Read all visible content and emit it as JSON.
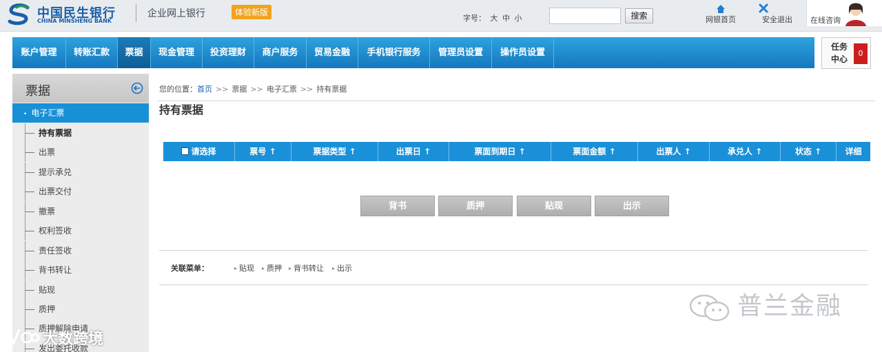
{
  "header": {
    "bank_name_cn": "中国民生银行",
    "bank_name_en": "CHINA MINSHENG BANK",
    "subtitle": "企业网上银行",
    "badge": "体验新版",
    "font_size_label": "字号：",
    "font_sizes": [
      "大",
      "中",
      "小"
    ],
    "search_value": "",
    "search_button": "搜索",
    "home_link": "网银首页",
    "logout_link": "安全退出",
    "consult": "在线咨询"
  },
  "nav": {
    "items": [
      "账户管理",
      "转账汇款",
      "票据",
      "现金管理",
      "投资理财",
      "商户服务",
      "贸易金融",
      "手机银行服务",
      "管理员设置",
      "操作员设置"
    ],
    "active": "票据"
  },
  "task_center": {
    "label": "任务中心",
    "count": "0"
  },
  "sidebar": {
    "title": "票据",
    "group": "电子汇票",
    "items": [
      "持有票据",
      "出票",
      "提示承兑",
      "出票交付",
      "撤票",
      "权利签收",
      "责任签收",
      "背书转让",
      "贴现",
      "质押",
      "质押解除申请",
      "发出委托收款"
    ],
    "active_item": "持有票据"
  },
  "breadcrumb": {
    "prefix": "您的位置：",
    "home": "首页",
    "sep": ">>",
    "parts": [
      "票据",
      "电子汇票",
      "持有票据"
    ]
  },
  "page_title": "持有票据",
  "table": {
    "select_label": "请选择",
    "sort_icon": "↑",
    "columns": [
      "票号",
      "票据类型",
      "出票日",
      "票面到期日",
      "票面金额",
      "出票人",
      "承兑人",
      "状态"
    ],
    "detail_column": "详细",
    "rows": []
  },
  "actions": [
    "背书",
    "质押",
    "贴现",
    "出示"
  ],
  "related": {
    "label": "关联菜单：",
    "links": [
      "贴现",
      "质押",
      "背书转让",
      "出示"
    ]
  },
  "watermark": {
    "text": "普兰金融",
    "text2": "大数跨境"
  },
  "colors": {
    "brand_blue": "#1a5fa8",
    "nav_blue": "#1478bf",
    "header_blue": "#1a90d8",
    "badge_orange": "#f3a21c",
    "task_red": "#cc1e1e"
  }
}
